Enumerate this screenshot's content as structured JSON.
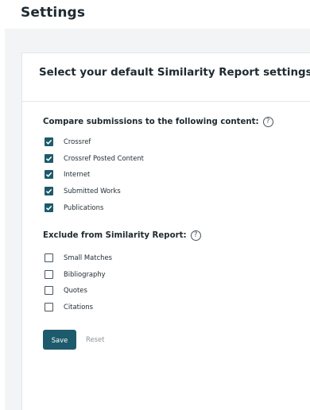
{
  "page": {
    "title": "Settings"
  },
  "card": {
    "title": "Select your default Similarity Report settings."
  },
  "compare": {
    "heading": "Compare submissions to the following content:",
    "help_icon": "question-circle-icon",
    "items": [
      {
        "label": "Crossref",
        "checked": true
      },
      {
        "label": "Crossref Posted Content",
        "checked": true
      },
      {
        "label": "Internet",
        "checked": true
      },
      {
        "label": "Submitted Works",
        "checked": true
      },
      {
        "label": "Publications",
        "checked": true
      }
    ]
  },
  "exclude": {
    "heading": "Exclude from Similarity Report:",
    "help_icon": "question-circle-icon",
    "items": [
      {
        "label": "Small Matches",
        "checked": false
      },
      {
        "label": "Bibliography",
        "checked": false
      },
      {
        "label": "Quotes",
        "checked": false
      },
      {
        "label": "Citations",
        "checked": false
      }
    ]
  },
  "actions": {
    "save_label": "Save",
    "reset_label": "Reset"
  },
  "colors": {
    "accent": "#1d5a6b",
    "background": "#f3f4f5",
    "text": "#1f2a30"
  }
}
